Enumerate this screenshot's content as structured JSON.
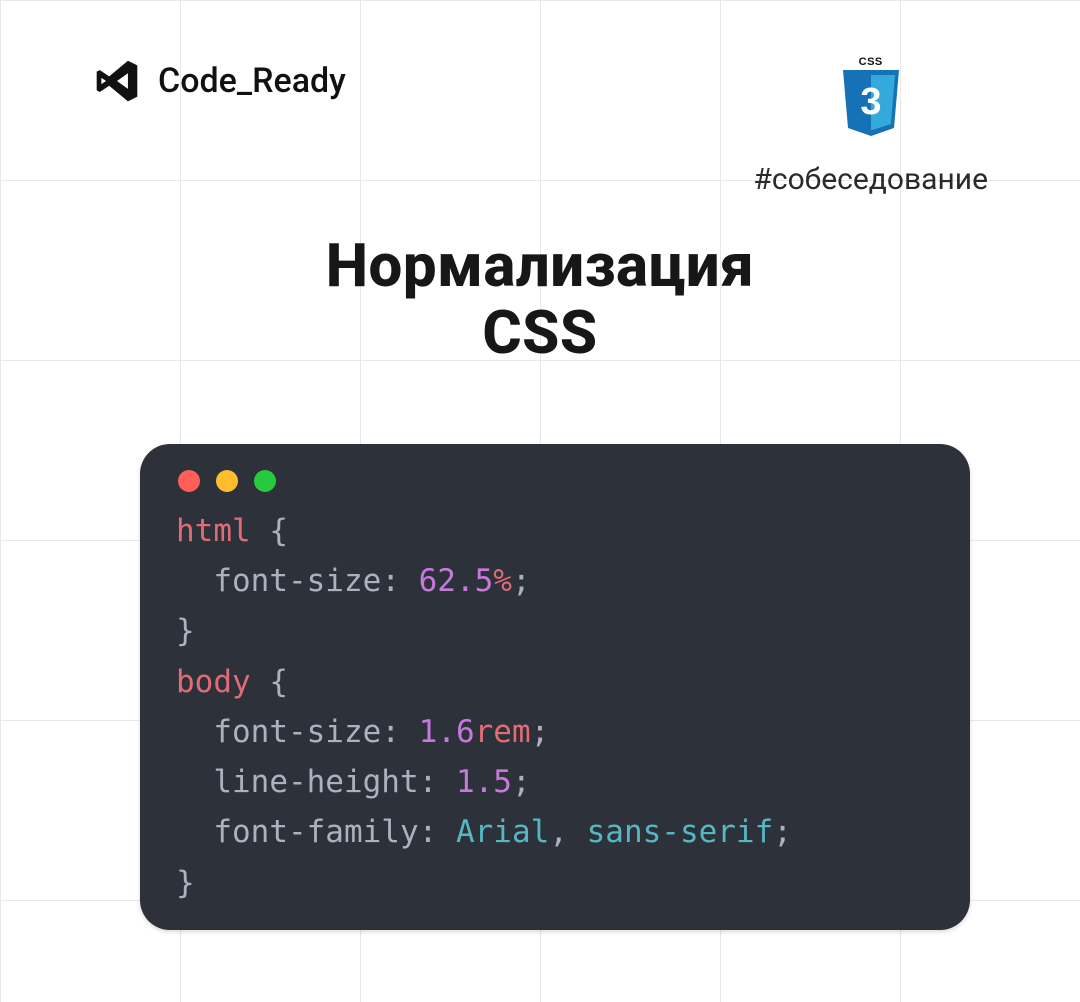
{
  "brand": {
    "label": "Code_Ready"
  },
  "badge": {
    "top_text": "CSS",
    "digit": "3"
  },
  "hashtag": "#собеседование",
  "title": {
    "line1": "Нормализация",
    "line2": "CSS"
  },
  "code": {
    "sel_html": "html",
    "sel_body": "body",
    "prop_font_size": "font-size",
    "prop_line_height": "line-height",
    "prop_font_family": "font-family",
    "val_625": "62.5",
    "unit_pct": "%",
    "val_16": "1.6",
    "unit_rem": "rem",
    "val_15": "1.5",
    "ff_arial": "Arial",
    "ff_sans": "sans-serif"
  },
  "icons": {
    "vs": "visual-studio-icon",
    "css3": "css3-shield-icon",
    "traffic_red": "close",
    "traffic_yellow": "minimize",
    "traffic_green": "zoom"
  },
  "colors": {
    "editor_bg": "#2c313a",
    "selector": "#e06c75",
    "number": "#c678dd",
    "unit": "#e06c75",
    "ident": "#56b6c2",
    "text": "#abb2bf",
    "shield": "#1572B6"
  }
}
